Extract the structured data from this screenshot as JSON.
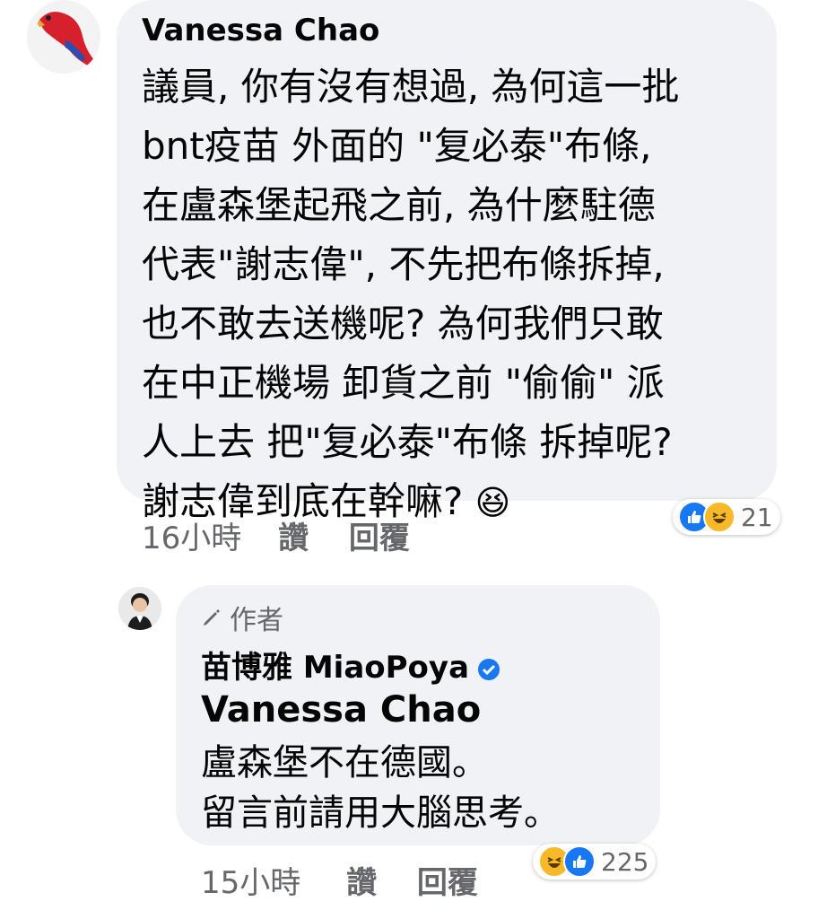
{
  "comment1": {
    "author": "Vanessa Chao",
    "text": "議員, 你有沒有想過, 為何這一批\nbnt疫苗 外面的 \"复必泰\"布條,\n在盧森堡起飛之前, 為什麼駐德\n代表\"謝志偉\", 不先把布條拆掉,\n也不敢去送機呢? 為何我們只敢\n在中正機場 卸貨之前 \"偷偷\" 派\n人上去 把\"复必泰\"布條 拆掉呢?\n謝志偉到底在幹嘛?",
    "emoji": "😆",
    "time": "16小時",
    "like_label": "讚",
    "reply_label": "回覆",
    "reactions": [
      "like-icon",
      "haha-icon"
    ],
    "reaction_count": "21"
  },
  "reply1": {
    "author_badge": "作者",
    "author": "苗博雅 MiaoPoya",
    "mention": "Vanessa Chao",
    "text": "盧森堡不在德國。\n留言前請用大腦思考。",
    "time": "15小時",
    "like_label": "讚",
    "reply_label": "回覆",
    "reactions": [
      "haha-icon",
      "like-icon"
    ],
    "reaction_count": "225"
  },
  "colors": {
    "bubble": "#f0f2f5",
    "meta_text": "#65676b",
    "like_blue": "#1877f2",
    "haha_yellow": "#f7b928",
    "verified_blue": "#1877f2"
  }
}
